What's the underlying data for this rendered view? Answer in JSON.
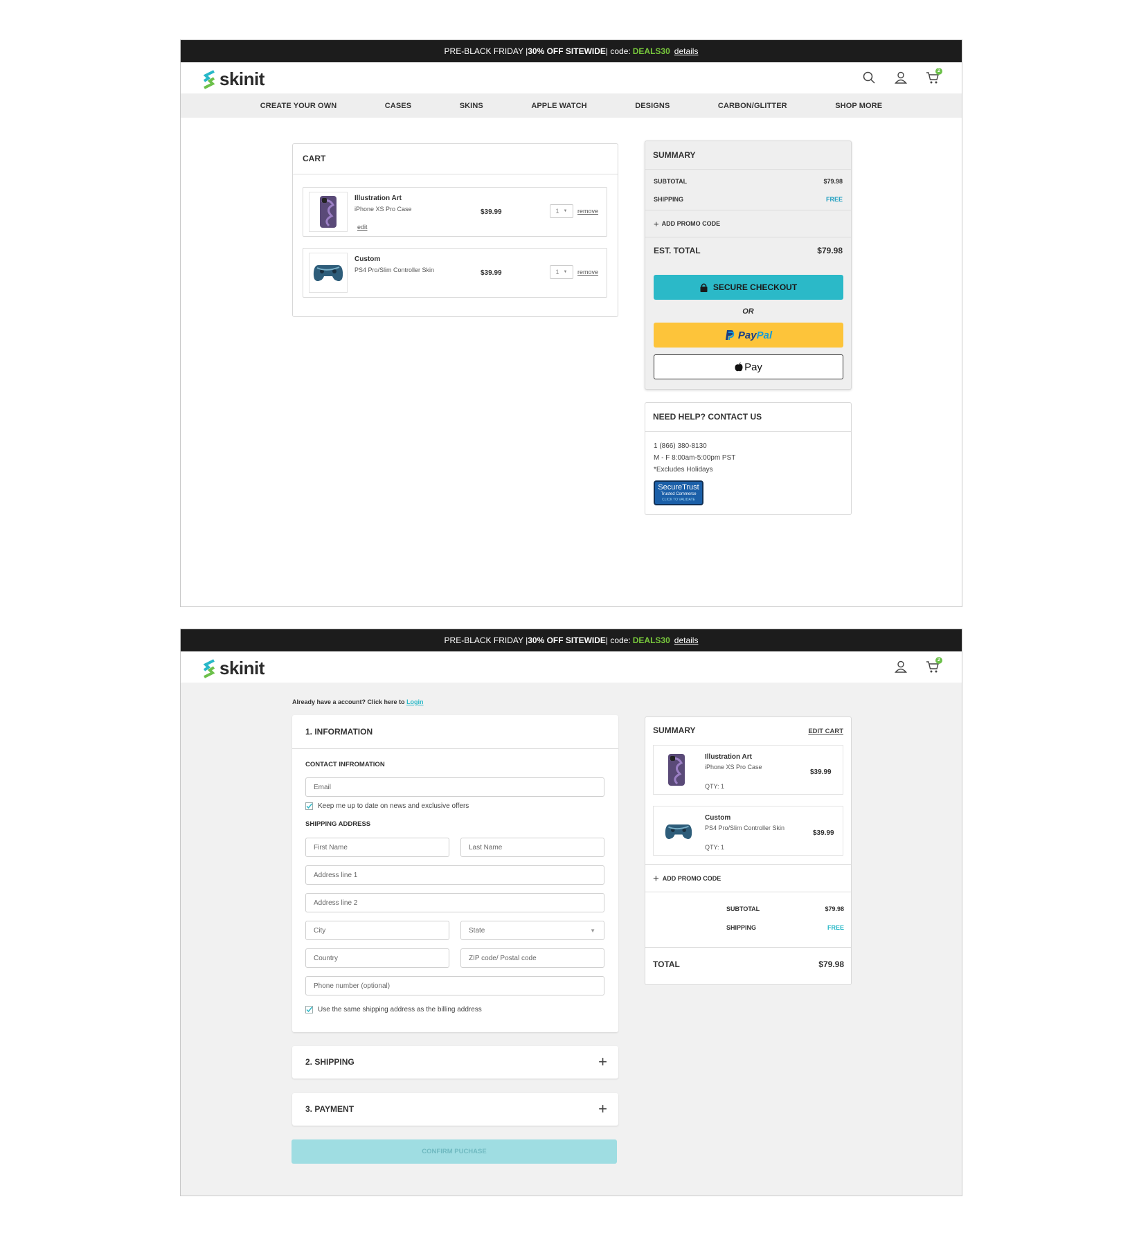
{
  "promo_bar": {
    "prefix": "PRE-BLACK FRIDAY | ",
    "highlight": "30% OFF SITEWIDE",
    "middle": " | code: ",
    "code": "DEALS30",
    "details": "details"
  },
  "brand": {
    "name": "skinit",
    "accent": "#28b8c8",
    "green": "#6cc04a"
  },
  "cart_count": "2",
  "nav": [
    "CREATE YOUR OWN",
    "CASES",
    "SKINS",
    "APPLE WATCH",
    "DESIGNS",
    "CARBON/GLITTER",
    "SHOP MORE"
  ],
  "cart_page": {
    "cart_title": "CART",
    "items": [
      {
        "name": "Illustration Art",
        "product": "iPhone XS Pro Case",
        "price": "$39.99",
        "qty": "1",
        "edit": "edit",
        "remove": "remove"
      },
      {
        "name": "Custom",
        "product": "PS4 Pro/Slim Controller Skin",
        "price": "$39.99",
        "qty": "1",
        "remove": "remove"
      }
    ],
    "summary": {
      "title": "SUMMARY",
      "subtotal_label": "SUBTOTAL",
      "subtotal": "$79.98",
      "shipping_label": "SHIPPING",
      "shipping": "FREE",
      "promo": "ADD PROMO CODE",
      "total_label": "EST. TOTAL",
      "total": "$79.98",
      "checkout": "SECURE CHECKOUT",
      "or": "OR",
      "paypal_a": "Pay",
      "paypal_b": "Pal",
      "applepay": "Pay"
    },
    "help": {
      "title": "NEED HELP? CONTACT US",
      "phone": "1 (866) 380-8130",
      "hours": "M - F 8:00am-5:00pm PST",
      "note": "*Excludes Holidays",
      "badge_title": "SecureTrust",
      "badge_sub": "Trusted Commerce",
      "badge_cta": "CLICK TO VALIDATE"
    }
  },
  "checkout_page": {
    "account_text": "Already have a account?  Click here to ",
    "login": "Login",
    "info_title": "1. INFORMATION",
    "contact_title": "CONTACT INFROMATION",
    "email_ph": "Email",
    "newsletter": "Keep me up to date on news and exclusive offers",
    "shipping_title": "SHIPPING ADDRESS",
    "first_name": "First Name",
    "last_name": "Last Name",
    "address1": "Address line 1",
    "address2": "Address line 2",
    "city": "City",
    "state": "State",
    "country": "Country",
    "zip": "ZIP code/ Postal code",
    "phone": "Phone number (optional)",
    "same_address": "Use the same shipping address as the billing address",
    "shipping_section": "2. SHIPPING",
    "payment_section": "3. PAYMENT",
    "confirm": "CONFIRM PUCHASE",
    "summary": {
      "title": "SUMMARY",
      "edit_cart": "EDIT CART",
      "items": [
        {
          "name": "Illustration Art",
          "product": "iPhone XS Pro Case",
          "price": "$39.99",
          "qty": "QTY: 1"
        },
        {
          "name": "Custom",
          "product": "PS4 Pro/Slim Controller Skin",
          "price": "$39.99",
          "qty": "QTY: 1"
        }
      ],
      "promo": "ADD PROMO CODE",
      "subtotal_label": "SUBTOTAL",
      "subtotal": "$79.98",
      "shipping_label": "SHIPPING",
      "shipping": "FREE",
      "total_label": "TOTAL",
      "total": "$79.98"
    }
  }
}
